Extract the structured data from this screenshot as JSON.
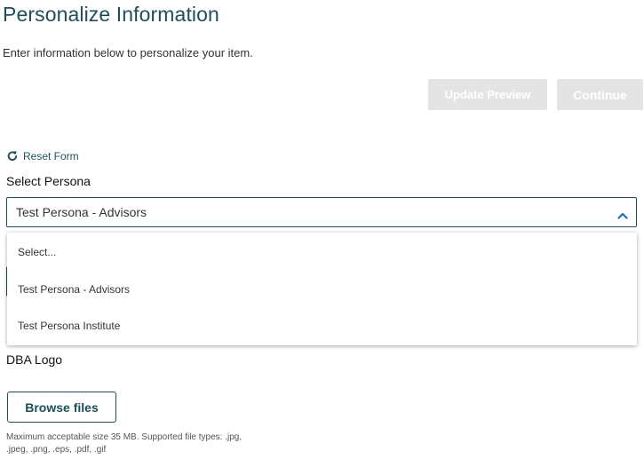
{
  "page": {
    "title": "Personalize Information",
    "intro": "Enter information below to personalize your item."
  },
  "actions": {
    "update_preview_label": "Update Preview",
    "continue_label": "Continue"
  },
  "reset": {
    "label": "Reset Form",
    "icon": "refresh-icon"
  },
  "persona": {
    "label": "Select Persona",
    "selected_value": "Test Persona - Advisors",
    "expanded": true,
    "chevron_icon": "chevron-up-icon",
    "options": [
      {
        "label": "Select..."
      },
      {
        "label": "Test Persona - Advisors"
      },
      {
        "label": "Test Persona Institute"
      }
    ]
  },
  "logo": {
    "label": "DBA Logo",
    "browse_label": "Browse files",
    "help_line1": "Maximum acceptable size 35 MB. Supported file types: .jpg,",
    "help_line2": ".jpeg, .png, .eps, .pdf, .gif"
  },
  "colors": {
    "accent": "#1f4e5a",
    "disabled_button": "#e4e4e4",
    "chevron": "#1f6fb5"
  }
}
